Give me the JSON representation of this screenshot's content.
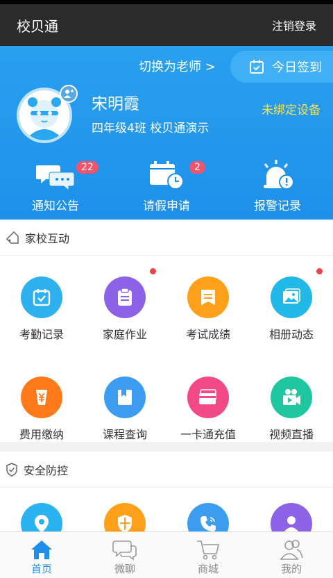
{
  "app_bar": {
    "title": "校贝通",
    "logout": "注销登录"
  },
  "hero": {
    "switch_label": "切换为老师 >",
    "checkin_label": "今日签到",
    "user_name": "宋明霞",
    "user_class": "四年级4班 校贝通演示",
    "device_status": "未绑定设备",
    "shortcuts": [
      {
        "label": "通知公告",
        "badge": "22",
        "icon": "chat-bubbles-icon"
      },
      {
        "label": "请假申请",
        "badge": "2",
        "icon": "calendar-clock-icon"
      },
      {
        "label": "报警记录",
        "badge": "",
        "icon": "alarm-icon"
      }
    ]
  },
  "sections": [
    {
      "title": "家校互动",
      "items": [
        {
          "label": "考勤记录",
          "color": "#2fb1f0",
          "icon": "calendar-check-icon",
          "dot": false
        },
        {
          "label": "家庭作业",
          "color": "#8c63e6",
          "icon": "clipboard-icon",
          "dot": true
        },
        {
          "label": "考试成绩",
          "color": "#ffa01a",
          "icon": "report-icon",
          "dot": false
        },
        {
          "label": "相册动态",
          "color": "#22b8e8",
          "icon": "photo-album-icon",
          "dot": true
        },
        {
          "label": "费用缴纳",
          "color": "#ff7a1a",
          "icon": "yuan-icon",
          "dot": false
        },
        {
          "label": "课程查询",
          "color": "#3b9cf0",
          "icon": "book-icon",
          "dot": false
        },
        {
          "label": "一卡通充值",
          "color": "#f24a86",
          "icon": "card-icon",
          "dot": false
        },
        {
          "label": "视频直播",
          "color": "#1ec7a0",
          "icon": "video-icon",
          "dot": false
        }
      ]
    },
    {
      "title": "安全防控",
      "items": [
        {
          "label": "",
          "color": "#2ab3f0",
          "icon": "location-icon"
        },
        {
          "label": "",
          "color": "#ffa01a",
          "icon": "shield-icon"
        },
        {
          "label": "",
          "color": "#3b9cf0",
          "icon": "phone-icon"
        },
        {
          "label": "",
          "color": "#8c63e6",
          "icon": "person-icon"
        }
      ]
    }
  ],
  "tabs": [
    {
      "label": "首页",
      "icon": "home-icon",
      "active": true
    },
    {
      "label": "微聊",
      "icon": "chat-icon",
      "active": false
    },
    {
      "label": "商城",
      "icon": "cart-icon",
      "active": false
    },
    {
      "label": "我的",
      "icon": "user-icon",
      "active": false
    }
  ],
  "colors": {
    "primary": "#1e90ea",
    "yellow": "#ffe14a",
    "badge": "#f2546b"
  }
}
